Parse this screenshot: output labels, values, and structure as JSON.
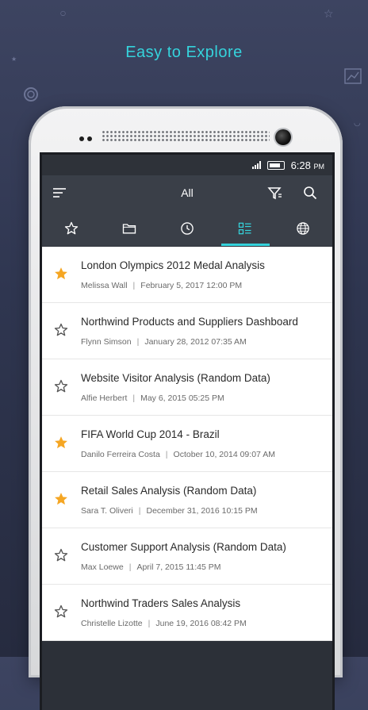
{
  "header": {
    "headline": "Easy to Explore"
  },
  "status_bar": {
    "time": "6:28",
    "ampm": "PM"
  },
  "toolbar": {
    "title": "All"
  },
  "tabs": [
    {
      "name": "favorites",
      "icon": "star-outline-icon"
    },
    {
      "name": "folders",
      "icon": "folder-icon"
    },
    {
      "name": "recent",
      "icon": "clock-icon"
    },
    {
      "name": "all",
      "icon": "list-icon",
      "active": true
    },
    {
      "name": "public",
      "icon": "globe-icon"
    }
  ],
  "colors": {
    "accent": "#35d3dc",
    "star": "#f5a623",
    "toolbar": "#3a3f48"
  },
  "items": [
    {
      "title": "London Olympics 2012 Medal Analysis",
      "author": "Melissa Wall",
      "date": "February 5, 2017",
      "time": "12:00 PM",
      "favorite": true
    },
    {
      "title": "Northwind Products and Suppliers Dashboard",
      "author": "Flynn Simson",
      "date": "January 28, 2012",
      "time": "07:35 AM",
      "favorite": false
    },
    {
      "title": "Website Visitor Analysis (Random Data)",
      "author": "Alfie Herbert",
      "date": "May 6, 2015",
      "time": "05:25 PM",
      "favorite": false
    },
    {
      "title": "FIFA World Cup 2014 - Brazil",
      "author": "Danilo Ferreira Costa",
      "date": "October 10, 2014",
      "time": "09:07 AM",
      "favorite": true
    },
    {
      "title": "Retail Sales Analysis (Random Data)",
      "author": "Sara T. Oliveri",
      "date": "December 31, 2016",
      "time": "10:15 PM",
      "favorite": true
    },
    {
      "title": "Customer Support Analysis (Random Data)",
      "author": "Max Loewe",
      "date": "April 7, 2015",
      "time": "11:45 PM",
      "favorite": false
    },
    {
      "title": "Northwind Traders Sales Analysis",
      "author": "Christelle Lizotte",
      "date": "June 19, 2016",
      "time": "08:42 PM",
      "favorite": false
    }
  ]
}
